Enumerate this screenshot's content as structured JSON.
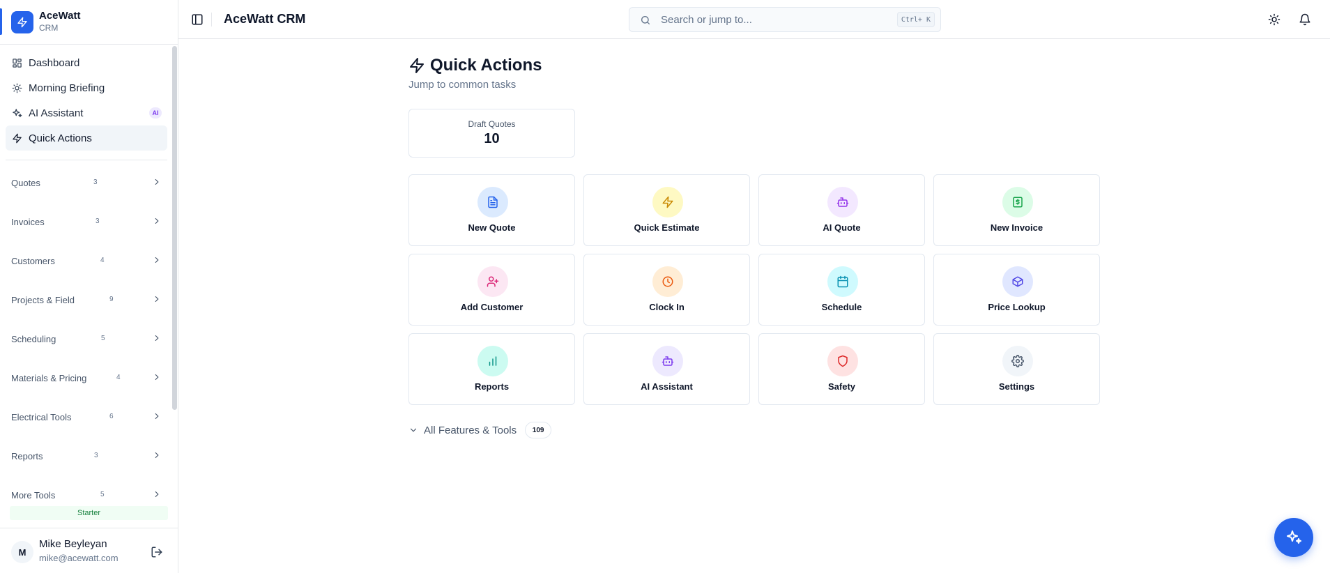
{
  "brand": {
    "name": "AceWatt",
    "sub": "CRM"
  },
  "nav": {
    "top": [
      {
        "label": "Dashboard",
        "icon": "grid-icon"
      },
      {
        "label": "Morning Briefing",
        "icon": "sun-icon"
      },
      {
        "label": "AI Assistant",
        "icon": "sparkles-icon",
        "badge": "AI"
      },
      {
        "label": "Quick Actions",
        "icon": "zap-icon",
        "active": true
      }
    ],
    "groups": [
      {
        "label": "Quotes",
        "count": "3"
      },
      {
        "label": "Invoices",
        "count": "3"
      },
      {
        "label": "Customers",
        "count": "4"
      },
      {
        "label": "Projects & Field",
        "count": "9"
      },
      {
        "label": "Scheduling",
        "count": "5"
      },
      {
        "label": "Materials & Pricing",
        "count": "4"
      },
      {
        "label": "Electrical Tools",
        "count": "6"
      },
      {
        "label": "Reports",
        "count": "3"
      },
      {
        "label": "More Tools",
        "count": "5"
      }
    ]
  },
  "plan": "Starter",
  "user": {
    "initial": "M",
    "name": "Mike Beyleyan",
    "email": "mike@acewatt.com"
  },
  "header": {
    "title": "AceWatt CRM",
    "search_placeholder": "Search or jump to...",
    "shortcut": "Ctrl+ K"
  },
  "main": {
    "title": "Quick Actions",
    "subtitle": "Jump to common tasks",
    "stat": {
      "label": "Draft Quotes",
      "value": "10"
    },
    "actions": [
      {
        "label": "New Quote",
        "icon": "file-text-icon",
        "bg": "#dbeafe",
        "fg": "#2563eb"
      },
      {
        "label": "Quick Estimate",
        "icon": "zap-icon",
        "bg": "#fef9c3",
        "fg": "#ca8a04"
      },
      {
        "label": "AI Quote",
        "icon": "bot-icon",
        "bg": "#f3e8ff",
        "fg": "#9333ea"
      },
      {
        "label": "New Invoice",
        "icon": "dollar-receipt-icon",
        "bg": "#dcfce7",
        "fg": "#16a34a"
      },
      {
        "label": "Add Customer",
        "icon": "user-plus-icon",
        "bg": "#fce7f3",
        "fg": "#db2777"
      },
      {
        "label": "Clock In",
        "icon": "clock-icon",
        "bg": "#ffedd5",
        "fg": "#ea580c"
      },
      {
        "label": "Schedule",
        "icon": "calendar-icon",
        "bg": "#cffafe",
        "fg": "#0891b2"
      },
      {
        "label": "Price Lookup",
        "icon": "package-icon",
        "bg": "#e0e7ff",
        "fg": "#4f46e5"
      },
      {
        "label": "Reports",
        "icon": "bar-chart-icon",
        "bg": "#ccfbf1",
        "fg": "#0d9488"
      },
      {
        "label": "AI Assistant",
        "icon": "bot-icon",
        "bg": "#ede9fe",
        "fg": "#7c3aed"
      },
      {
        "label": "Safety",
        "icon": "shield-icon",
        "bg": "#fee2e2",
        "fg": "#dc2626"
      },
      {
        "label": "Settings",
        "icon": "gear-icon",
        "bg": "#f1f5f9",
        "fg": "#475569"
      }
    ],
    "features": {
      "label": "All Features & Tools",
      "count": "109"
    }
  },
  "colors": {
    "accent": "#2563eb",
    "plan_bg": "#f0fdf4",
    "plan_fg": "#15803d"
  }
}
